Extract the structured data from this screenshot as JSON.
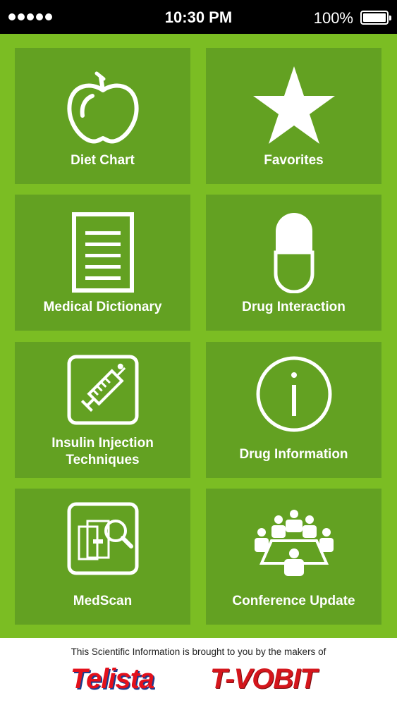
{
  "status_bar": {
    "time": "10:30 PM",
    "battery_percent": "100%",
    "signal_icon": "signal-dots-icon",
    "battery_icon": "battery-full-icon"
  },
  "menu": {
    "tiles": [
      {
        "label_lines": [
          "Diet Chart"
        ],
        "icon": "apple-icon"
      },
      {
        "label_lines": [
          "Favorites"
        ],
        "icon": "star-icon"
      },
      {
        "label_lines": [
          "Medical Dictionary"
        ],
        "icon": "document-icon"
      },
      {
        "label_lines": [
          "Drug Interaction"
        ],
        "icon": "capsule-icon"
      },
      {
        "label_lines": [
          "Insulin Injection",
          "Techniques"
        ],
        "icon": "syringe-icon"
      },
      {
        "label_lines": [
          "Drug Information"
        ],
        "icon": "info-icon"
      },
      {
        "label_lines": [
          "MedScan"
        ],
        "icon": "book-magnifier-icon"
      },
      {
        "label_lines": [
          "Conference Update"
        ],
        "icon": "conference-icon"
      }
    ]
  },
  "footer": {
    "sponsor_text": "This Scientific Information is brought to you by the makers of",
    "brand_left": "Telista",
    "brand_right": "T-VOBIT"
  },
  "colors": {
    "background_green": "#7bbd23",
    "tile_green": "#63a122",
    "brand_red": "#e3101b",
    "brand_blue": "#1b3c8e"
  }
}
